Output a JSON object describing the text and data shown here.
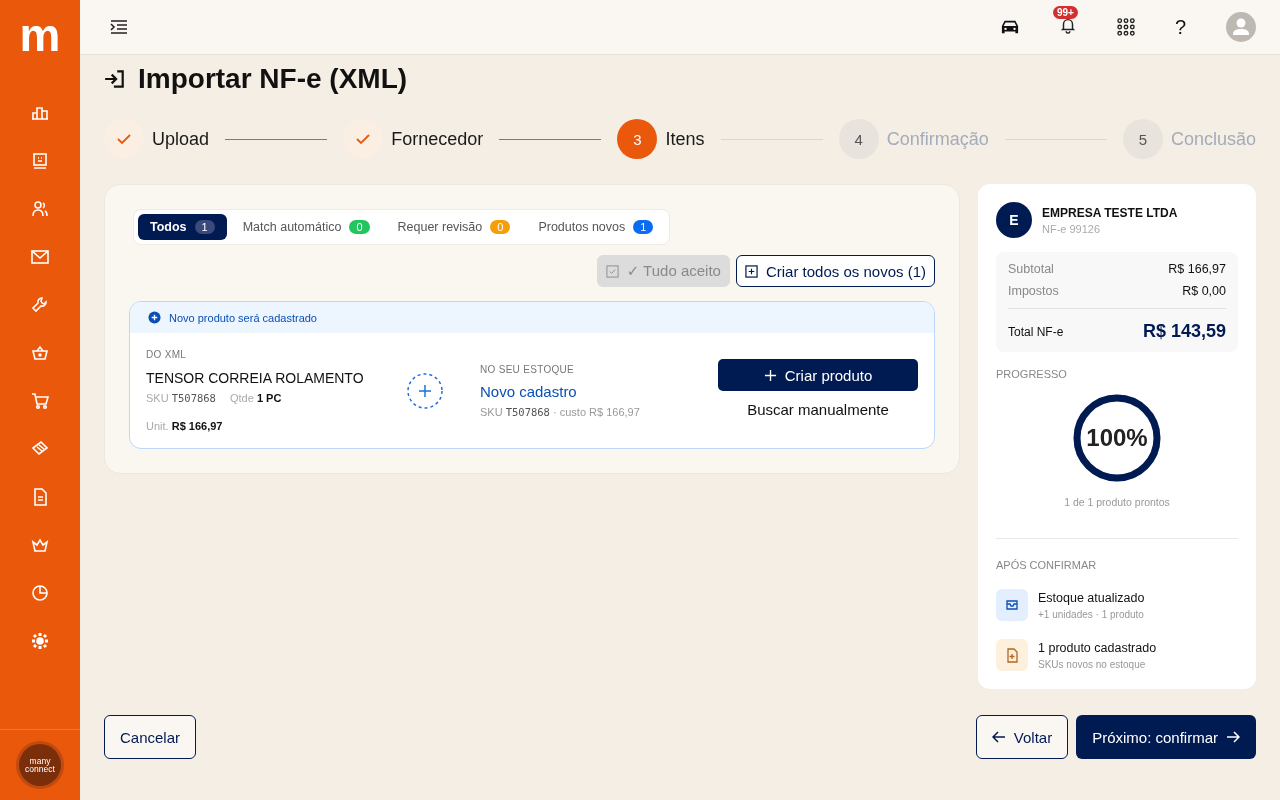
{
  "brand": {
    "logo_letter": "m",
    "footer_logo": "many connect"
  },
  "header": {
    "notification_badge": "99+",
    "help": "?"
  },
  "page": {
    "title": "Importar NF-e (XML)"
  },
  "steps": [
    {
      "label": "Upload",
      "done": true,
      "selected": false
    },
    {
      "label": "Fornecedor",
      "done": true,
      "selected": false
    },
    {
      "number": "3",
      "label": "Itens",
      "done": false,
      "selected": true
    },
    {
      "number": "4",
      "label": "Confirmação",
      "done": false,
      "selected": false
    },
    {
      "number": "5",
      "label": "Conclusão",
      "done": false,
      "selected": false
    }
  ],
  "filters": [
    {
      "label": "Todos",
      "count": "1",
      "selected": true,
      "color": "#3a4a7c"
    },
    {
      "label": "Match automático",
      "count": "0",
      "selected": false,
      "color": "#22c55e"
    },
    {
      "label": "Requer revisão",
      "count": "0",
      "selected": false,
      "color": "#f59e0b"
    },
    {
      "label": "Produtos novos",
      "count": "1",
      "selected": false,
      "color": "#0b6cf0"
    }
  ],
  "actions": [
    {
      "label": "✓ Tudo aceito",
      "disabled": true
    },
    {
      "label": "Criar todos os novos (1)",
      "disabled": false
    }
  ],
  "item": {
    "banner": "Novo produto será cadastrado",
    "xml_label": "DO XML",
    "name": "TENSOR CORREIA ROLAMENTO",
    "sku_label": "SKU",
    "sku": "T507868",
    "qty_label": "Qtde",
    "qty": "1 PC",
    "unit_label": "Unit.",
    "unit": "R$ 166,97",
    "stock_label": "NO SEU ESTOQUE",
    "stock_name": "Novo cadastro",
    "stock_sku_label": "SKU",
    "stock_sku": "T507868",
    "stock_cost": "· custo R$ 166,97",
    "primary": "Criar produto",
    "secondary": "Buscar manualmente"
  },
  "summary": {
    "avatar": "E",
    "company": "EMPRESA TESTE LTDA",
    "nfe": "NF-e 99126",
    "rows": [
      {
        "label": "Subtotal",
        "value": "R$ 166,97"
      },
      {
        "label": "Impostos",
        "value": "R$ 0,00"
      }
    ],
    "total_label": "Total NF-e",
    "total": "R$ 143,59",
    "progress_label": "PROGRESSO",
    "level": 1,
    "percent": "100%",
    "progress_caption": "1 de 1 produto prontos",
    "after_label": "APÓS CONFIRMAR",
    "effects": [
      {
        "kind": "stock",
        "title": "Estoque atualizado",
        "subtitle": "+1 unidades · 1 produto"
      },
      {
        "kind": "new",
        "title": "1 produto cadastrado",
        "subtitle": "SKUs novos no estoque"
      }
    ]
  },
  "footer": {
    "cancel": "Cancelar",
    "back": "Voltar",
    "next": "Próximo: confirmar"
  }
}
